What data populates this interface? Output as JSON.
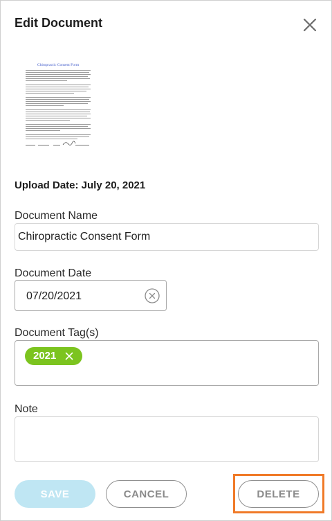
{
  "dialog": {
    "title": "Edit Document",
    "upload_date_label": "Upload Date: July 20, 2021"
  },
  "document_name": {
    "label": "Document Name",
    "value": "Chiropractic Consent Form"
  },
  "document_date": {
    "label": "Document Date",
    "value": "07/20/2021"
  },
  "tags": {
    "label": "Document Tag(s)",
    "items": [
      "2021"
    ]
  },
  "note": {
    "label": "Note",
    "value": ""
  },
  "buttons": {
    "save": "SAVE",
    "cancel": "CANCEL",
    "delete": "DELETE"
  },
  "thumbnail": {
    "heading": "Chiropractic Consent Form"
  },
  "colors": {
    "tag_chip": "#7cc41f",
    "save_disabled": "#bfe6f3",
    "highlight": "#f07a28",
    "thumbnail_heading": "#3b56c9"
  },
  "icons": {
    "close": "close-icon",
    "clear_date": "clear-circle-icon",
    "tag_remove": "tag-remove-icon"
  }
}
